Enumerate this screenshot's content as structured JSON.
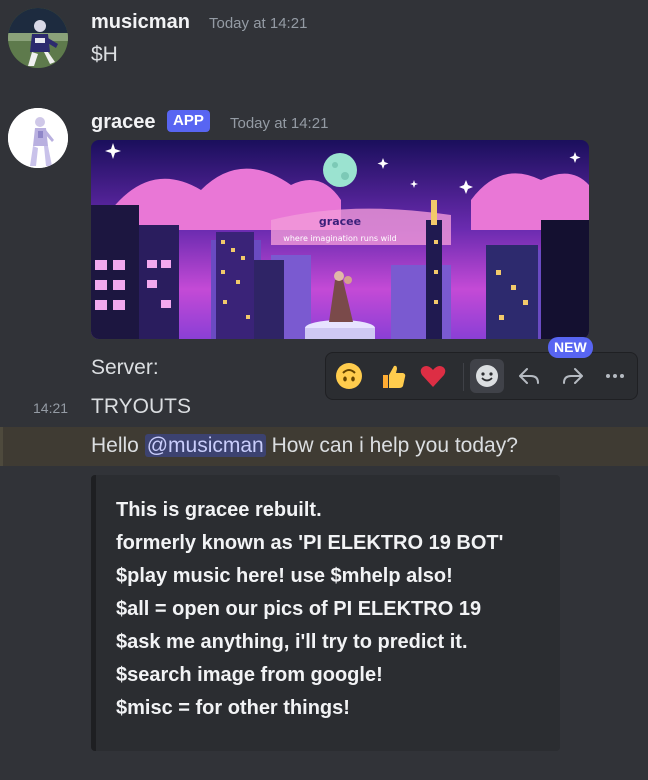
{
  "messages": [
    {
      "username": "musicman",
      "timestamp": "Today at 14:21",
      "content": "$H"
    },
    {
      "username": "gracee",
      "badge": "APP",
      "timestamp": "Today at 14:21",
      "banner": {
        "title": "gracee",
        "subtitle": "where imagination runs wild"
      },
      "lines": [
        "Server:",
        "TRYOUTS"
      ],
      "hover_time": "14:21"
    }
  ],
  "reply": {
    "prefix": "Hello",
    "mention": "@musicman",
    "suffix": "How can i help you today?"
  },
  "embed": {
    "lines": [
      "This is gracee rebuilt.",
      "formerly known as 'PI ELEKTRO 19 BOT'",
      "$play music here! use $mhelp also!",
      "$all = open our pics of PI ELEKTRO 19",
      "$ask me anything, i'll try to predict it.",
      "$search image from google!",
      "$misc = for other things!"
    ],
    "border_color": "#1e1f22"
  },
  "toolbar": {
    "new_label": "NEW",
    "icons": [
      "upside-down-face-icon",
      "thumbs-up-icon",
      "heart-icon",
      "add-reaction-icon",
      "reply-icon",
      "forward-icon",
      "more-icon"
    ]
  },
  "colors": {
    "background": "#313338",
    "brand": "#5865f2",
    "highlight": "#3f3b33"
  }
}
